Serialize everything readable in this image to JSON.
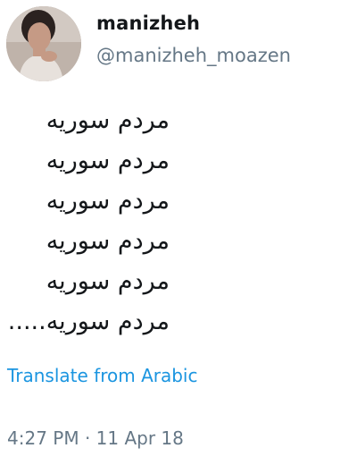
{
  "user": {
    "display_name": "manizheh",
    "username": "@manizheh_moazen",
    "avatar_icon": "profile-photo"
  },
  "tweet": {
    "lines": [
      "مردم سوریه",
      "مردم سوریه",
      "مردم سوریه",
      "مردم سوریه",
      "مردم سوریه",
      "مردم سوریه....."
    ],
    "translate_label": "Translate from Arabic",
    "timestamp": "4:27 PM · 11 Apr 18"
  },
  "colors": {
    "text": "#14171a",
    "secondary": "#657786",
    "link": "#1b95e0"
  }
}
